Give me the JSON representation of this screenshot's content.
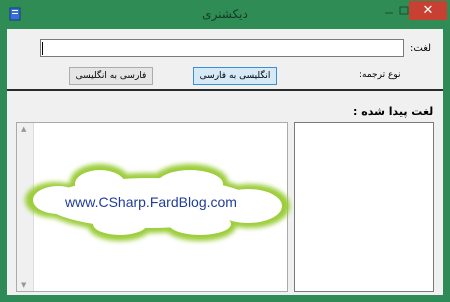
{
  "window": {
    "title": "دیکشنری",
    "close_glyph": "✕"
  },
  "form": {
    "word_label": "لغت:",
    "word_value": "",
    "translation_type_label": "نوع ترجمه:",
    "en_to_fa_button": "انگلیسی به فارسی",
    "fa_to_en_button": "فارسی به انگلیسی",
    "found_word_label": "لغت پیدا شده :"
  },
  "watermark": {
    "text": "www.CSharp.FardBlog.com"
  },
  "colors": {
    "title_bar": "#2f8c55",
    "close_button": "#c84031",
    "watermark_cloud_glow": "#9ccd3a",
    "watermark_text": "#1f3d99"
  },
  "icons": {
    "app": "book-icon",
    "minimize": "minimize-icon",
    "maximize": "maximize-icon",
    "close": "close-icon"
  }
}
